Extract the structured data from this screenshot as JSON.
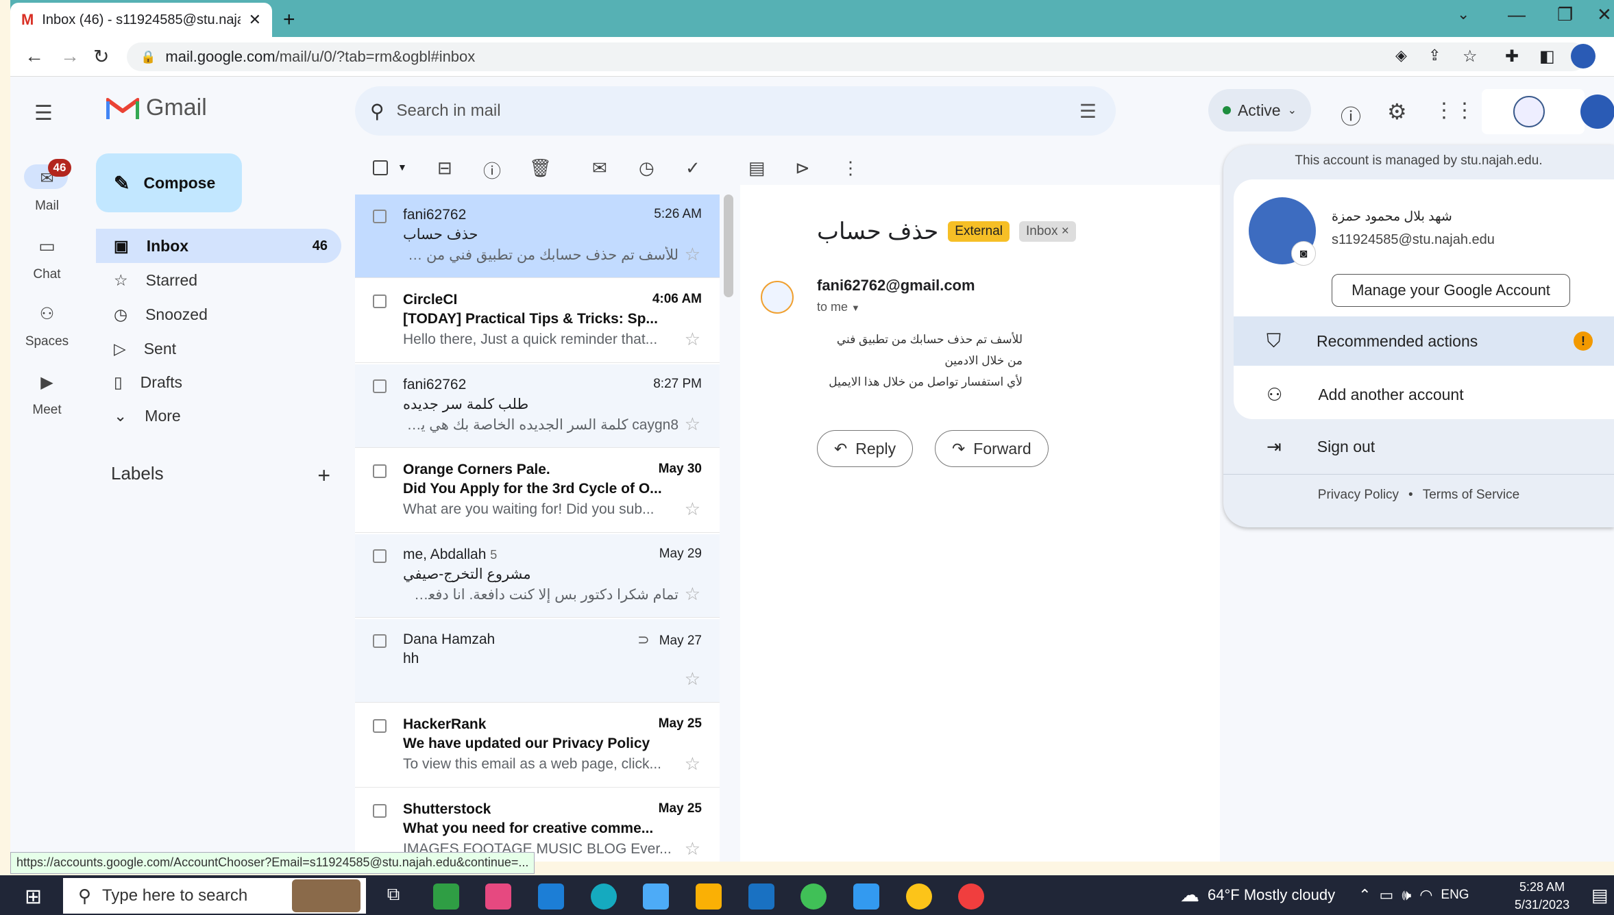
{
  "browser": {
    "tab_title": "Inbox (46) - s11924585@stu.najah",
    "url_domain": "mail.google.com",
    "url_path": "/mail/u/0/?tab=rm&ogbl#inbox",
    "new_tab": "+"
  },
  "gmail": {
    "brand": "Gmail",
    "search_placeholder": "Search in mail",
    "status": "Active",
    "rail": [
      {
        "label": "Mail",
        "badge": "46",
        "icon": "mail-icon"
      },
      {
        "label": "Chat",
        "icon": "chat-icon"
      },
      {
        "label": "Spaces",
        "icon": "spaces-icon"
      },
      {
        "label": "Meet",
        "icon": "meet-icon"
      }
    ],
    "compose": "Compose",
    "nav": [
      {
        "label": "Inbox",
        "count": "46",
        "icon": "inbox-icon"
      },
      {
        "label": "Starred",
        "icon": "star-icon"
      },
      {
        "label": "Snoozed",
        "icon": "clock-icon"
      },
      {
        "label": "Sent",
        "icon": "send-icon"
      },
      {
        "label": "Drafts",
        "icon": "draft-icon"
      },
      {
        "label": "More",
        "icon": "chevron-down-icon"
      }
    ],
    "labels_title": "Labels",
    "labels_add": "+",
    "messages": [
      {
        "from": "fani62762",
        "date": "5:26 AM",
        "subject": "حذف حساب",
        "snippet": "للأسف تم حذف حسابك من تطبيق فني من خلال الادمي...",
        "state": "selected"
      },
      {
        "from": "CircleCI",
        "date": "4:06 AM",
        "subject": "[TODAY] Practical Tips & Tricks: Sp...",
        "snippet": "Hello there, Just a quick reminder that...",
        "state": "unread"
      },
      {
        "from": "fani62762",
        "date": "8:27 PM",
        "subject": "طلب كلمة سر جديده",
        "snippet": "caygn8 كلمة السر الجديده الخاصة بك هي يرجى الد...",
        "state": "read"
      },
      {
        "from": "Orange Corners Pale.",
        "date": "May 30",
        "subject": "Did You Apply for the 3rd Cycle of O...",
        "snippet": "What are you waiting for! Did you sub...",
        "state": "unread"
      },
      {
        "from": "me, Abdallah",
        "count": "5",
        "date": "May 29",
        "subject": "مشروع التخرج-صيفي",
        "snippet": "تمام شكرا دكتور بس إلا كنت دافعة. انا دفعت الي ولفن...",
        "state": "read"
      },
      {
        "from": "Dana Hamzah",
        "date": "May 27",
        "subject": "hh",
        "snippet": "",
        "attachment": true,
        "state": "read"
      },
      {
        "from": "HackerRank",
        "date": "May 25",
        "subject": "We have updated our Privacy Policy",
        "snippet": "To view this email as a web page, click...",
        "state": "unread"
      },
      {
        "from": "Shutterstock",
        "date": "May 25",
        "subject": "What you need for creative comme...",
        "snippet": "IMAGES FOOTAGE MUSIC BLOG Ever...",
        "state": "unread"
      }
    ],
    "reader": {
      "subject": "حذف حساب",
      "chip_external": "External",
      "chip_inbox": "Inbox",
      "chip_close": "×",
      "sender": "fani62762@gmail.com",
      "to": "to me",
      "body": [
        "للأسف تم حذف حسابك من تطبيق فني",
        "من خلال الادمين",
        "لأي استفسار تواصل من خلال هذا الايميل"
      ],
      "reply": "Reply",
      "forward": "Forward"
    },
    "account": {
      "managed": "This account is managed by stu.najah.edu.",
      "name": "شهد بلال محمود حمزة",
      "email": "s11924585@stu.najah.edu",
      "manage": "Manage your Google Account",
      "recommended": "Recommended actions",
      "add": "Add another account",
      "signout": "Sign out",
      "privacy": "Privacy Policy",
      "dot": "•",
      "terms": "Terms of Service"
    }
  },
  "status_url": "https://accounts.google.com/AccountChooser?Email=s11924585@stu.najah.edu&continue=...",
  "taskbar": {
    "search": "Type here to search",
    "weather": "64°F  Mostly cloudy",
    "lang": "ENG",
    "time": "5:28 AM",
    "date": "5/31/2023"
  },
  "colors": {
    "accent": "#c2e7ff",
    "selected_row": "#c2dbff",
    "external_chip": "#f6bf26",
    "unread_badge": "#b3261e",
    "tabbar": "#56b1b4"
  }
}
